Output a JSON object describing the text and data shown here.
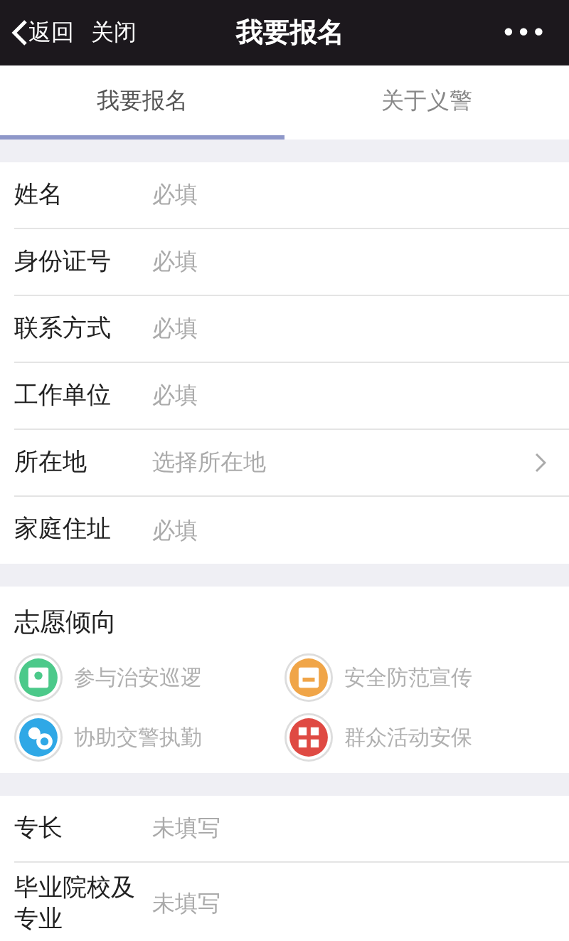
{
  "nav_bar": {
    "back": "返回",
    "close": "关闭",
    "title": "我要报名",
    "more": "•••"
  },
  "tabs": [
    {
      "label": "我要报名",
      "selected": true
    },
    {
      "label": "关于义警",
      "selected": false
    }
  ],
  "form_fields": [
    {
      "kind": "input",
      "label": "姓名",
      "placeholder": "必填"
    },
    {
      "kind": "input",
      "label": "身份证号",
      "placeholder": "必填"
    },
    {
      "kind": "input",
      "label": "联系方式",
      "placeholder": "必填"
    },
    {
      "kind": "input",
      "label": "工作单位",
      "placeholder": "必填"
    },
    {
      "kind": "select",
      "label": "所在地",
      "placeholder": "选择所在地"
    },
    {
      "kind": "input",
      "label": "家庭住址",
      "placeholder": "必填"
    }
  ],
  "volunteer": {
    "title": "志愿倾向",
    "options": [
      {
        "label": "参与治安巡逻",
        "color": "#4cc98a",
        "selected": false
      },
      {
        "label": "安全防范宣传",
        "color": "#f0a548",
        "selected": false
      },
      {
        "label": "协助交警执勤",
        "color": "#2fa8e6",
        "selected": false
      },
      {
        "label": "群众活动安保",
        "color": "#df4a43",
        "selected": false
      }
    ]
  },
  "extra_fields": [
    {
      "label": "专长",
      "placeholder": "未填写"
    },
    {
      "label": "毕业院校及专业",
      "placeholder": "未填写"
    }
  ]
}
